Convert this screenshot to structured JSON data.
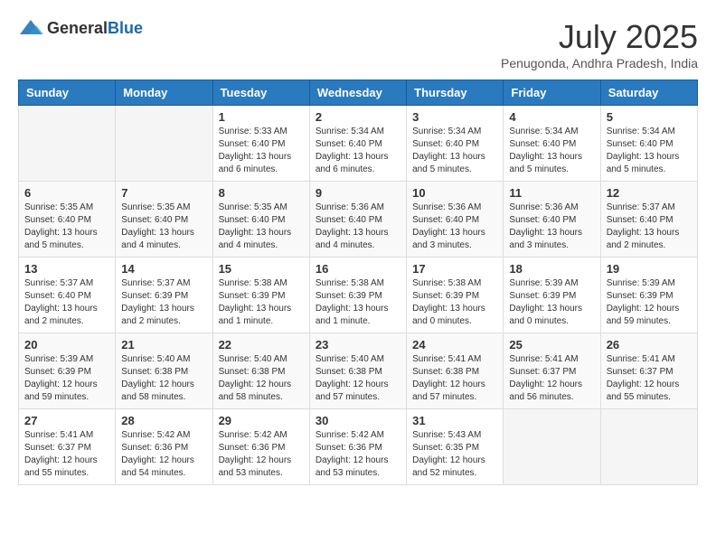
{
  "logo": {
    "general": "General",
    "blue": "Blue"
  },
  "title": {
    "month_year": "July 2025",
    "location": "Penugonda, Andhra Pradesh, India"
  },
  "weekdays": [
    "Sunday",
    "Monday",
    "Tuesday",
    "Wednesday",
    "Thursday",
    "Friday",
    "Saturday"
  ],
  "weeks": [
    [
      {
        "day": "",
        "sunrise": "",
        "sunset": "",
        "daylight": ""
      },
      {
        "day": "",
        "sunrise": "",
        "sunset": "",
        "daylight": ""
      },
      {
        "day": "1",
        "sunrise": "Sunrise: 5:33 AM",
        "sunset": "Sunset: 6:40 PM",
        "daylight": "Daylight: 13 hours and 6 minutes."
      },
      {
        "day": "2",
        "sunrise": "Sunrise: 5:34 AM",
        "sunset": "Sunset: 6:40 PM",
        "daylight": "Daylight: 13 hours and 6 minutes."
      },
      {
        "day": "3",
        "sunrise": "Sunrise: 5:34 AM",
        "sunset": "Sunset: 6:40 PM",
        "daylight": "Daylight: 13 hours and 5 minutes."
      },
      {
        "day": "4",
        "sunrise": "Sunrise: 5:34 AM",
        "sunset": "Sunset: 6:40 PM",
        "daylight": "Daylight: 13 hours and 5 minutes."
      },
      {
        "day": "5",
        "sunrise": "Sunrise: 5:34 AM",
        "sunset": "Sunset: 6:40 PM",
        "daylight": "Daylight: 13 hours and 5 minutes."
      }
    ],
    [
      {
        "day": "6",
        "sunrise": "Sunrise: 5:35 AM",
        "sunset": "Sunset: 6:40 PM",
        "daylight": "Daylight: 13 hours and 5 minutes."
      },
      {
        "day": "7",
        "sunrise": "Sunrise: 5:35 AM",
        "sunset": "Sunset: 6:40 PM",
        "daylight": "Daylight: 13 hours and 4 minutes."
      },
      {
        "day": "8",
        "sunrise": "Sunrise: 5:35 AM",
        "sunset": "Sunset: 6:40 PM",
        "daylight": "Daylight: 13 hours and 4 minutes."
      },
      {
        "day": "9",
        "sunrise": "Sunrise: 5:36 AM",
        "sunset": "Sunset: 6:40 PM",
        "daylight": "Daylight: 13 hours and 4 minutes."
      },
      {
        "day": "10",
        "sunrise": "Sunrise: 5:36 AM",
        "sunset": "Sunset: 6:40 PM",
        "daylight": "Daylight: 13 hours and 3 minutes."
      },
      {
        "day": "11",
        "sunrise": "Sunrise: 5:36 AM",
        "sunset": "Sunset: 6:40 PM",
        "daylight": "Daylight: 13 hours and 3 minutes."
      },
      {
        "day": "12",
        "sunrise": "Sunrise: 5:37 AM",
        "sunset": "Sunset: 6:40 PM",
        "daylight": "Daylight: 13 hours and 2 minutes."
      }
    ],
    [
      {
        "day": "13",
        "sunrise": "Sunrise: 5:37 AM",
        "sunset": "Sunset: 6:40 PM",
        "daylight": "Daylight: 13 hours and 2 minutes."
      },
      {
        "day": "14",
        "sunrise": "Sunrise: 5:37 AM",
        "sunset": "Sunset: 6:39 PM",
        "daylight": "Daylight: 13 hours and 2 minutes."
      },
      {
        "day": "15",
        "sunrise": "Sunrise: 5:38 AM",
        "sunset": "Sunset: 6:39 PM",
        "daylight": "Daylight: 13 hours and 1 minute."
      },
      {
        "day": "16",
        "sunrise": "Sunrise: 5:38 AM",
        "sunset": "Sunset: 6:39 PM",
        "daylight": "Daylight: 13 hours and 1 minute."
      },
      {
        "day": "17",
        "sunrise": "Sunrise: 5:38 AM",
        "sunset": "Sunset: 6:39 PM",
        "daylight": "Daylight: 13 hours and 0 minutes."
      },
      {
        "day": "18",
        "sunrise": "Sunrise: 5:39 AM",
        "sunset": "Sunset: 6:39 PM",
        "daylight": "Daylight: 13 hours and 0 minutes."
      },
      {
        "day": "19",
        "sunrise": "Sunrise: 5:39 AM",
        "sunset": "Sunset: 6:39 PM",
        "daylight": "Daylight: 12 hours and 59 minutes."
      }
    ],
    [
      {
        "day": "20",
        "sunrise": "Sunrise: 5:39 AM",
        "sunset": "Sunset: 6:39 PM",
        "daylight": "Daylight: 12 hours and 59 minutes."
      },
      {
        "day": "21",
        "sunrise": "Sunrise: 5:40 AM",
        "sunset": "Sunset: 6:38 PM",
        "daylight": "Daylight: 12 hours and 58 minutes."
      },
      {
        "day": "22",
        "sunrise": "Sunrise: 5:40 AM",
        "sunset": "Sunset: 6:38 PM",
        "daylight": "Daylight: 12 hours and 58 minutes."
      },
      {
        "day": "23",
        "sunrise": "Sunrise: 5:40 AM",
        "sunset": "Sunset: 6:38 PM",
        "daylight": "Daylight: 12 hours and 57 minutes."
      },
      {
        "day": "24",
        "sunrise": "Sunrise: 5:41 AM",
        "sunset": "Sunset: 6:38 PM",
        "daylight": "Daylight: 12 hours and 57 minutes."
      },
      {
        "day": "25",
        "sunrise": "Sunrise: 5:41 AM",
        "sunset": "Sunset: 6:37 PM",
        "daylight": "Daylight: 12 hours and 56 minutes."
      },
      {
        "day": "26",
        "sunrise": "Sunrise: 5:41 AM",
        "sunset": "Sunset: 6:37 PM",
        "daylight": "Daylight: 12 hours and 55 minutes."
      }
    ],
    [
      {
        "day": "27",
        "sunrise": "Sunrise: 5:41 AM",
        "sunset": "Sunset: 6:37 PM",
        "daylight": "Daylight: 12 hours and 55 minutes."
      },
      {
        "day": "28",
        "sunrise": "Sunrise: 5:42 AM",
        "sunset": "Sunset: 6:36 PM",
        "daylight": "Daylight: 12 hours and 54 minutes."
      },
      {
        "day": "29",
        "sunrise": "Sunrise: 5:42 AM",
        "sunset": "Sunset: 6:36 PM",
        "daylight": "Daylight: 12 hours and 53 minutes."
      },
      {
        "day": "30",
        "sunrise": "Sunrise: 5:42 AM",
        "sunset": "Sunset: 6:36 PM",
        "daylight": "Daylight: 12 hours and 53 minutes."
      },
      {
        "day": "31",
        "sunrise": "Sunrise: 5:43 AM",
        "sunset": "Sunset: 6:35 PM",
        "daylight": "Daylight: 12 hours and 52 minutes."
      },
      {
        "day": "",
        "sunrise": "",
        "sunset": "",
        "daylight": ""
      },
      {
        "day": "",
        "sunrise": "",
        "sunset": "",
        "daylight": ""
      }
    ]
  ]
}
